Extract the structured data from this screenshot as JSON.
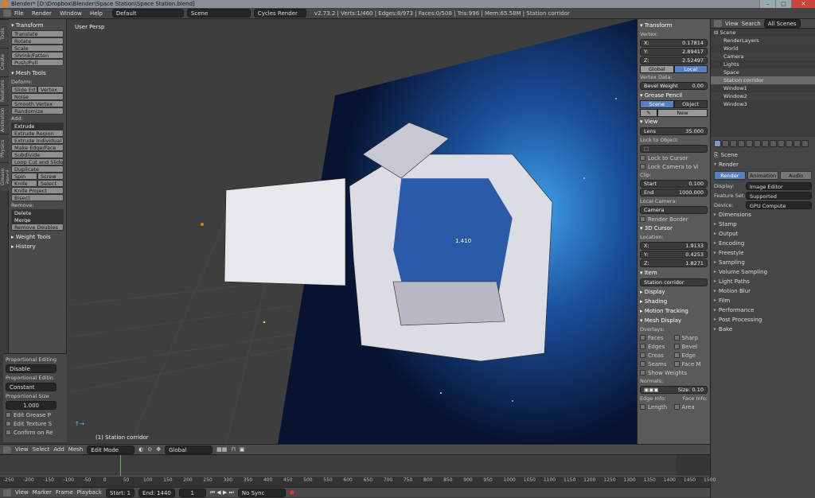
{
  "title": "Blender* [D:\\Dropbox\\Blender\\Space Station\\Space Station.blend]",
  "window_buttons": [
    "–",
    "□",
    "✕"
  ],
  "info_header": {
    "menus": [
      "File",
      "Render",
      "Window",
      "Help"
    ],
    "layout": "Default",
    "scene": "Scene",
    "engine": "Cycles Render",
    "stats": "v2.73.2 | Verts:1/460 | Edges:8/973 | Faces:0/508 | Tris:996 | Mem:65.58M | Station corridor"
  },
  "left_tabs": [
    "Tools",
    "Create",
    "Relations",
    "Animation",
    "Physics",
    "Grease Pencil"
  ],
  "tool_panel": {
    "transform_header": "▾ Transform",
    "transform": [
      "Translate",
      "Rotate",
      "Scale",
      "Shrink/Fatten",
      "Push/Pull"
    ],
    "mesh_tools_header": "▾ Mesh Tools",
    "deform_label": "Deform:",
    "slide": [
      "Slide Ed",
      "Vertex"
    ],
    "deform": [
      "Noise",
      "Smooth Vertex",
      "Randomize"
    ],
    "add_label": "Add:",
    "extrude_menu": "Extrude",
    "add": [
      "Extrude Region",
      "Extrude Individual",
      "Make Edge/Face",
      "Subdivide",
      "Loop Cut and Slide",
      "Duplicate"
    ],
    "spin_row": [
      "Spin",
      "Screw"
    ],
    "knife_row": [
      "Knife",
      "Select"
    ],
    "add2": [
      "Knife Project",
      "Bisect"
    ],
    "remove_label": "Remove:",
    "delete_menu": "Delete",
    "merge_menu": "Merge",
    "remove_doubles": "Remove Doubles",
    "weight_tools": "▸ Weight Tools",
    "history": "▸ History"
  },
  "prop_box": {
    "prop_edit_label": "Proportional Editing",
    "prop_edit_value": "Disable",
    "prop_falloff_label": "Proportional Editin",
    "prop_falloff_value": "Constant",
    "prop_size_label": "Proportional Size",
    "prop_size_value": "1.000",
    "checks": [
      "Edit Grease P",
      "Edit Texture S",
      "Confirm on Re"
    ]
  },
  "viewport": {
    "view_label": "User Persp",
    "object_label": "(1) Station corridor",
    "measure": "1.410"
  },
  "n_panel": {
    "transform": "▾ Transform",
    "vertex_label": "Vertex:",
    "x": "0.17814",
    "y": "2.89417",
    "z": "2.52497",
    "global": "Global",
    "local": "Local",
    "vertex_data": "Vertex Data:",
    "bevel_weight": "Bevel Weight",
    "bevel_value": "0.00",
    "grease_pencil": "▾ Grease Pencil",
    "scene_btn": "Scene",
    "object_btn": "Object",
    "new_btn": "New",
    "view": "▾ View",
    "lens_label": "Lens",
    "lens_value": "35.000",
    "lock_to_object": "Lock to Object:",
    "lock_to_cursor": "Lock to Cursor",
    "lock_camera": "Lock Camera to Vi",
    "clip": "Clip:",
    "clip_start_label": "Start",
    "clip_start_value": "0.100",
    "clip_end_label": "End",
    "clip_end_value": "1000.000",
    "local_camera": "Local Camera:",
    "camera_field": "Camera",
    "render_border": "Render Border",
    "cursor_3d": "▾ 3D Cursor",
    "location": "Location:",
    "cx": "1.9133",
    "cy": "0.4253",
    "cz": "1.8271",
    "item": "▾ Item",
    "item_name": "Station corridor",
    "display": "▸ Display",
    "shading": "▸ Shading",
    "motion_tracking": "▸ Motion Tracking",
    "mesh_display": "▾ Mesh Display",
    "overlays": "Overlays:",
    "ov_left": [
      "Faces",
      "Edges",
      "Creas",
      "Seams",
      "Show Weights"
    ],
    "ov_right": [
      "Sharp",
      "Bevel",
      "Edge",
      "Face M"
    ],
    "normals": "Normals:",
    "normal_size": "Size: 0.10",
    "edge_info": "Edge Info:",
    "face_info": "Face Info:",
    "length": "Length",
    "area": "Area"
  },
  "outliner": {
    "view": "View",
    "search": "Search",
    "filter": "All Scenes",
    "rows": [
      "Scene",
      "RenderLayers",
      "World",
      "Camera",
      "Lights",
      "Space",
      "Station corridor",
      "Window1",
      "Window2",
      "Window3"
    ]
  },
  "properties": {
    "scene": "Scene",
    "render_header": "Render",
    "render_tabs": [
      "Render",
      "Animation",
      "Audio"
    ],
    "display_label": "Display:",
    "display_value": "Image Editor",
    "feature_label": "Feature Set:",
    "feature_value": "Supported",
    "device_label": "Device:",
    "device_value": "GPU Compute",
    "sections": [
      "Dimensions",
      "Stamp",
      "Output",
      "Encoding",
      "Freestyle",
      "Sampling",
      "Volume Sampling",
      "Light Paths",
      "Motion Blur",
      "Film",
      "Performance",
      "Post Processing",
      "Bake"
    ]
  },
  "view3d_header": {
    "menus": [
      "View",
      "Select",
      "Add",
      "Mesh"
    ],
    "mode": "Edit Mode",
    "orientation": "Global"
  },
  "timeline": {
    "ticks": [
      "-250",
      "-200",
      "-150",
      "-100",
      "-50",
      "0",
      "50",
      "100",
      "150",
      "200",
      "250",
      "300",
      "350",
      "400",
      "450",
      "500",
      "550",
      "600",
      "650",
      "700",
      "750",
      "800",
      "850",
      "900",
      "950",
      "1000",
      "1050",
      "1100",
      "1150",
      "1200",
      "1250",
      "1300",
      "1350",
      "1400",
      "1450",
      "1500"
    ],
    "menus": [
      "View",
      "Marker",
      "Frame",
      "Playback"
    ],
    "start_label": "Start:",
    "start_value": "1",
    "end_label": "End:",
    "end_value": "1440",
    "current": "1",
    "sync": "No Sync"
  }
}
